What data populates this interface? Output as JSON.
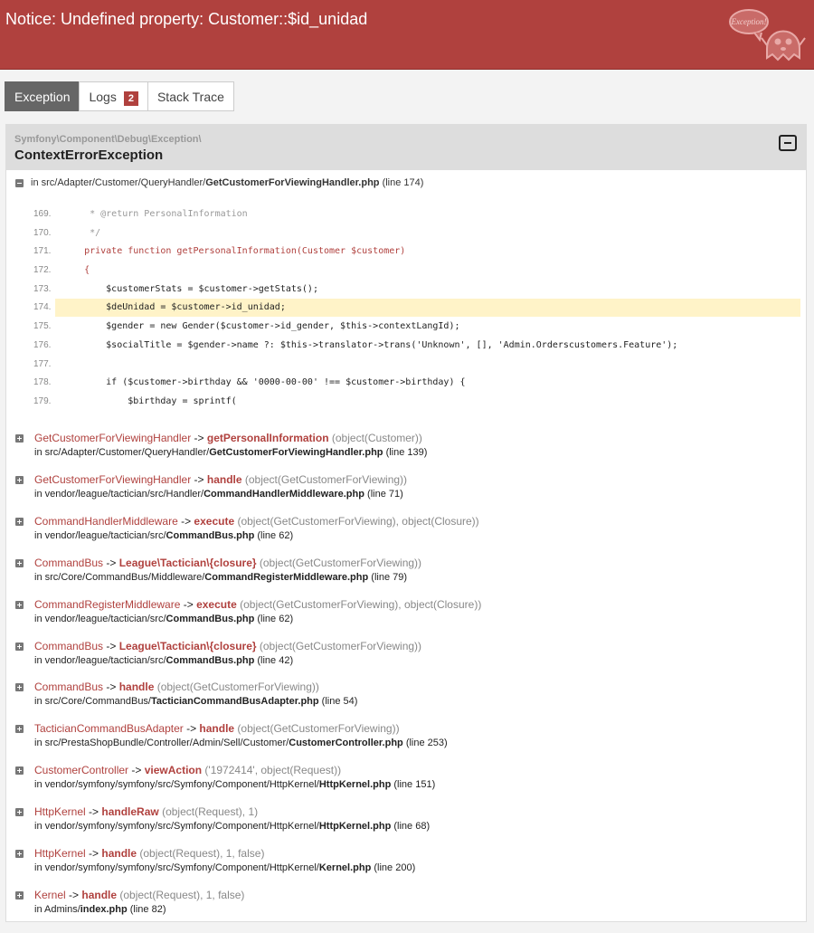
{
  "header": {
    "title": "Notice: Undefined property: Customer::$id_unidad",
    "logo_text": "Exception!"
  },
  "tabs": [
    {
      "label": "Exception",
      "active": true
    },
    {
      "label": "Logs",
      "badge": "2"
    },
    {
      "label": "Stack Trace"
    }
  ],
  "exception": {
    "namespace": "Symfony\\Component\\Debug\\Exception\\",
    "class": "ContextErrorException",
    "first_location": {
      "prefix": "in src/Adapter/Customer/QueryHandler/",
      "file": "GetCustomerForViewingHandler.php",
      "line": "(line 174)"
    }
  },
  "code_lines": [
    {
      "num": "169.",
      "text": "     * @return PersonalInformation",
      "type": "com"
    },
    {
      "num": "170.",
      "text": "     */",
      "type": "com"
    },
    {
      "num": "171.",
      "text": "    private function getPersonalInformation(Customer $customer)",
      "type": "kw"
    },
    {
      "num": "172.",
      "text": "    {",
      "type": "kw"
    },
    {
      "num": "173.",
      "text": "        $customerStats = $customer->getStats();",
      "type": ""
    },
    {
      "num": "174.",
      "text": "        $deUnidad = $customer->id_unidad;",
      "type": "",
      "highlight": true
    },
    {
      "num": "175.",
      "text": "        $gender = new Gender($customer->id_gender, $this->contextLangId);",
      "type": ""
    },
    {
      "num": "176.",
      "text": "        $socialTitle = $gender->name ?: $this->translator->trans('Unknown', [], 'Admin.Orderscustomers.Feature');",
      "type": ""
    },
    {
      "num": "177.",
      "text": "",
      "type": ""
    },
    {
      "num": "178.",
      "text": "        if ($customer->birthday && '0000-00-00' !== $customer->birthday) {",
      "type": ""
    },
    {
      "num": "179.",
      "text": "            $birthday = sprintf(",
      "type": ""
    }
  ],
  "trace": [
    {
      "cls": "GetCustomerForViewingHandler",
      "method": "getPersonalInformation",
      "args": "(object(Customer))",
      "path": "in src/Adapter/Customer/QueryHandler/",
      "file": "GetCustomerForViewingHandler.php",
      "line": "(line 139)"
    },
    {
      "cls": "GetCustomerForViewingHandler",
      "method": "handle",
      "args": "(object(GetCustomerForViewing))",
      "path": "in vendor/league/tactician/src/Handler/",
      "file": "CommandHandlerMiddleware.php",
      "line": "(line 71)"
    },
    {
      "cls": "CommandHandlerMiddleware",
      "method": "execute",
      "args": "(object(GetCustomerForViewing), object(Closure))",
      "path": "in vendor/league/tactician/src/",
      "file": "CommandBus.php",
      "line": "(line 62)"
    },
    {
      "cls": "CommandBus",
      "method": "League\\Tactician\\{closure}",
      "args": "(object(GetCustomerForViewing))",
      "path": "in src/Core/CommandBus/Middleware/",
      "file": "CommandRegisterMiddleware.php",
      "line": "(line 79)"
    },
    {
      "cls": "CommandRegisterMiddleware",
      "method": "execute",
      "args": "(object(GetCustomerForViewing), object(Closure))",
      "path": "in vendor/league/tactician/src/",
      "file": "CommandBus.php",
      "line": "(line 62)"
    },
    {
      "cls": "CommandBus",
      "method": "League\\Tactician\\{closure}",
      "args": "(object(GetCustomerForViewing))",
      "path": "in vendor/league/tactician/src/",
      "file": "CommandBus.php",
      "line": "(line 42)"
    },
    {
      "cls": "CommandBus",
      "method": "handle",
      "args": "(object(GetCustomerForViewing))",
      "path": "in src/Core/CommandBus/",
      "file": "TacticianCommandBusAdapter.php",
      "line": "(line 54)"
    },
    {
      "cls": "TacticianCommandBusAdapter",
      "method": "handle",
      "args": "(object(GetCustomerForViewing))",
      "path": "in src/PrestaShopBundle/Controller/Admin/Sell/Customer/",
      "file": "CustomerController.php",
      "line": "(line 253)"
    },
    {
      "cls": "CustomerController",
      "method": "viewAction",
      "args": "('1972414', object(Request))",
      "path": "in vendor/symfony/symfony/src/Symfony/Component/HttpKernel/",
      "file": "HttpKernel.php",
      "line": "(line 151)"
    },
    {
      "cls": "HttpKernel",
      "method": "handleRaw",
      "args": "(object(Request), 1)",
      "path": "in vendor/symfony/symfony/src/Symfony/Component/HttpKernel/",
      "file": "HttpKernel.php",
      "line": "(line 68)"
    },
    {
      "cls": "HttpKernel",
      "method": "handle",
      "args": "(object(Request), 1, false)",
      "path": "in vendor/symfony/symfony/src/Symfony/Component/HttpKernel/",
      "file": "Kernel.php",
      "line": "(line 200)"
    },
    {
      "cls": "Kernel",
      "method": "handle",
      "args": "(object(Request), 1, false)",
      "path": "in Admins/",
      "file": "index.php",
      "line": "(line 82)"
    }
  ]
}
